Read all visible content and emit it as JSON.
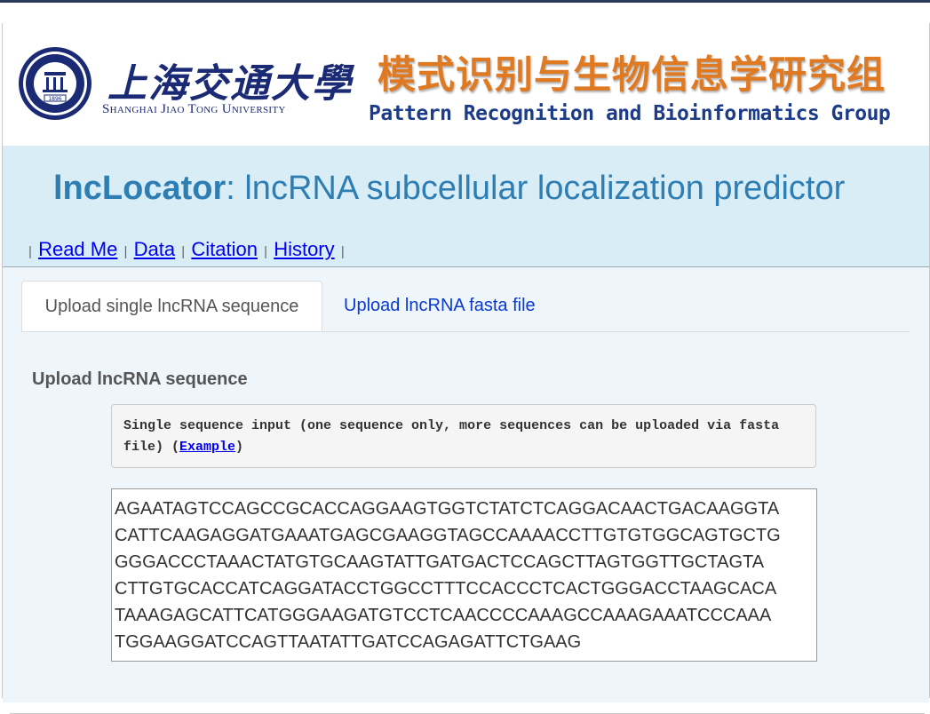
{
  "header": {
    "university_cn": "上海交通大學",
    "university_en": "Shanghai Jiao Tong University",
    "emblem_year": "1896",
    "group_cn": "模式识别与生物信息学研究组",
    "group_en": "Pattern Recognition and Bioinformatics Group"
  },
  "title": {
    "name": "lncLocator",
    "rest": ": lncRNA subcellular localization predictor"
  },
  "nav": {
    "items": [
      "Read Me",
      "Data",
      "Citation",
      "History"
    ],
    "separator": "|"
  },
  "tabs": [
    {
      "label": "Upload single lncRNA sequence",
      "active": true
    },
    {
      "label": "Upload lncRNA fasta file",
      "active": false
    }
  ],
  "form": {
    "section_title": "Upload lncRNA sequence",
    "hint_text": "Single sequence input (one sequence only, more sequences can be uploaded via fasta file)  (",
    "hint_link": "Example",
    "hint_close": ")",
    "sequence_value": "AGAATAGTCCAGCCGCACCAGGAAGTGGTCTATCTCAGGACAACTGACAAGGTA\nCATTCAAGAGGATGAAATGAGCGAAGGTAGCCAAAACCTTGTGTGGCAGTGCTG\nGGGACCCTAAACTATGTGCAAGTATTGATGACTCCAGCTTAGTGGTTGCTAGTA\nCTTGTGCACCATCAGGATACCTGGCCTTTCCACCCTCACTGGGACCTAAGCACA\nTAAAGAGCATTCATGGGAAGATGTCCTCAACCCCAAAGCCAAAGAAATCCCAAA\nTGGAAGGATCCAGTTAATATTGATCCAGAGATTCTGAAG"
  },
  "colors": {
    "title_band": "#d9edf7",
    "title_text": "#2e7eb3",
    "group_cn": "#e07a22",
    "group_en": "#1c3c8a",
    "university": "#1a2a75"
  }
}
